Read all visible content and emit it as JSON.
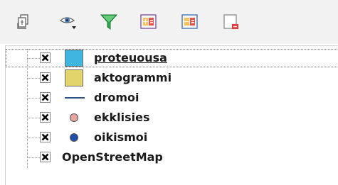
{
  "toolbar": {
    "buttons": [
      {
        "name": "add-group-icon"
      },
      {
        "name": "manage-visibility-icon"
      },
      {
        "name": "filter-legend-icon"
      },
      {
        "name": "expand-all-icon"
      },
      {
        "name": "collapse-all-icon"
      },
      {
        "name": "remove-layer-icon"
      }
    ]
  },
  "layers": [
    {
      "label": "proteuousa",
      "checked": true,
      "symbol": "fill",
      "color": "#3fb6df",
      "underlined": true
    },
    {
      "label": "aktogrammi",
      "checked": true,
      "symbol": "fill",
      "color": "#e3d36b"
    },
    {
      "label": "dromoi",
      "checked": true,
      "symbol": "line",
      "color": "#2c4f86"
    },
    {
      "label": "ekklisies",
      "checked": true,
      "symbol": "point",
      "color": "#e7a2a2"
    },
    {
      "label": "oikismoi",
      "checked": true,
      "symbol": "point",
      "color": "#1f4ea8"
    },
    {
      "label": "OpenStreetMap",
      "checked": true,
      "symbol": "none"
    }
  ]
}
